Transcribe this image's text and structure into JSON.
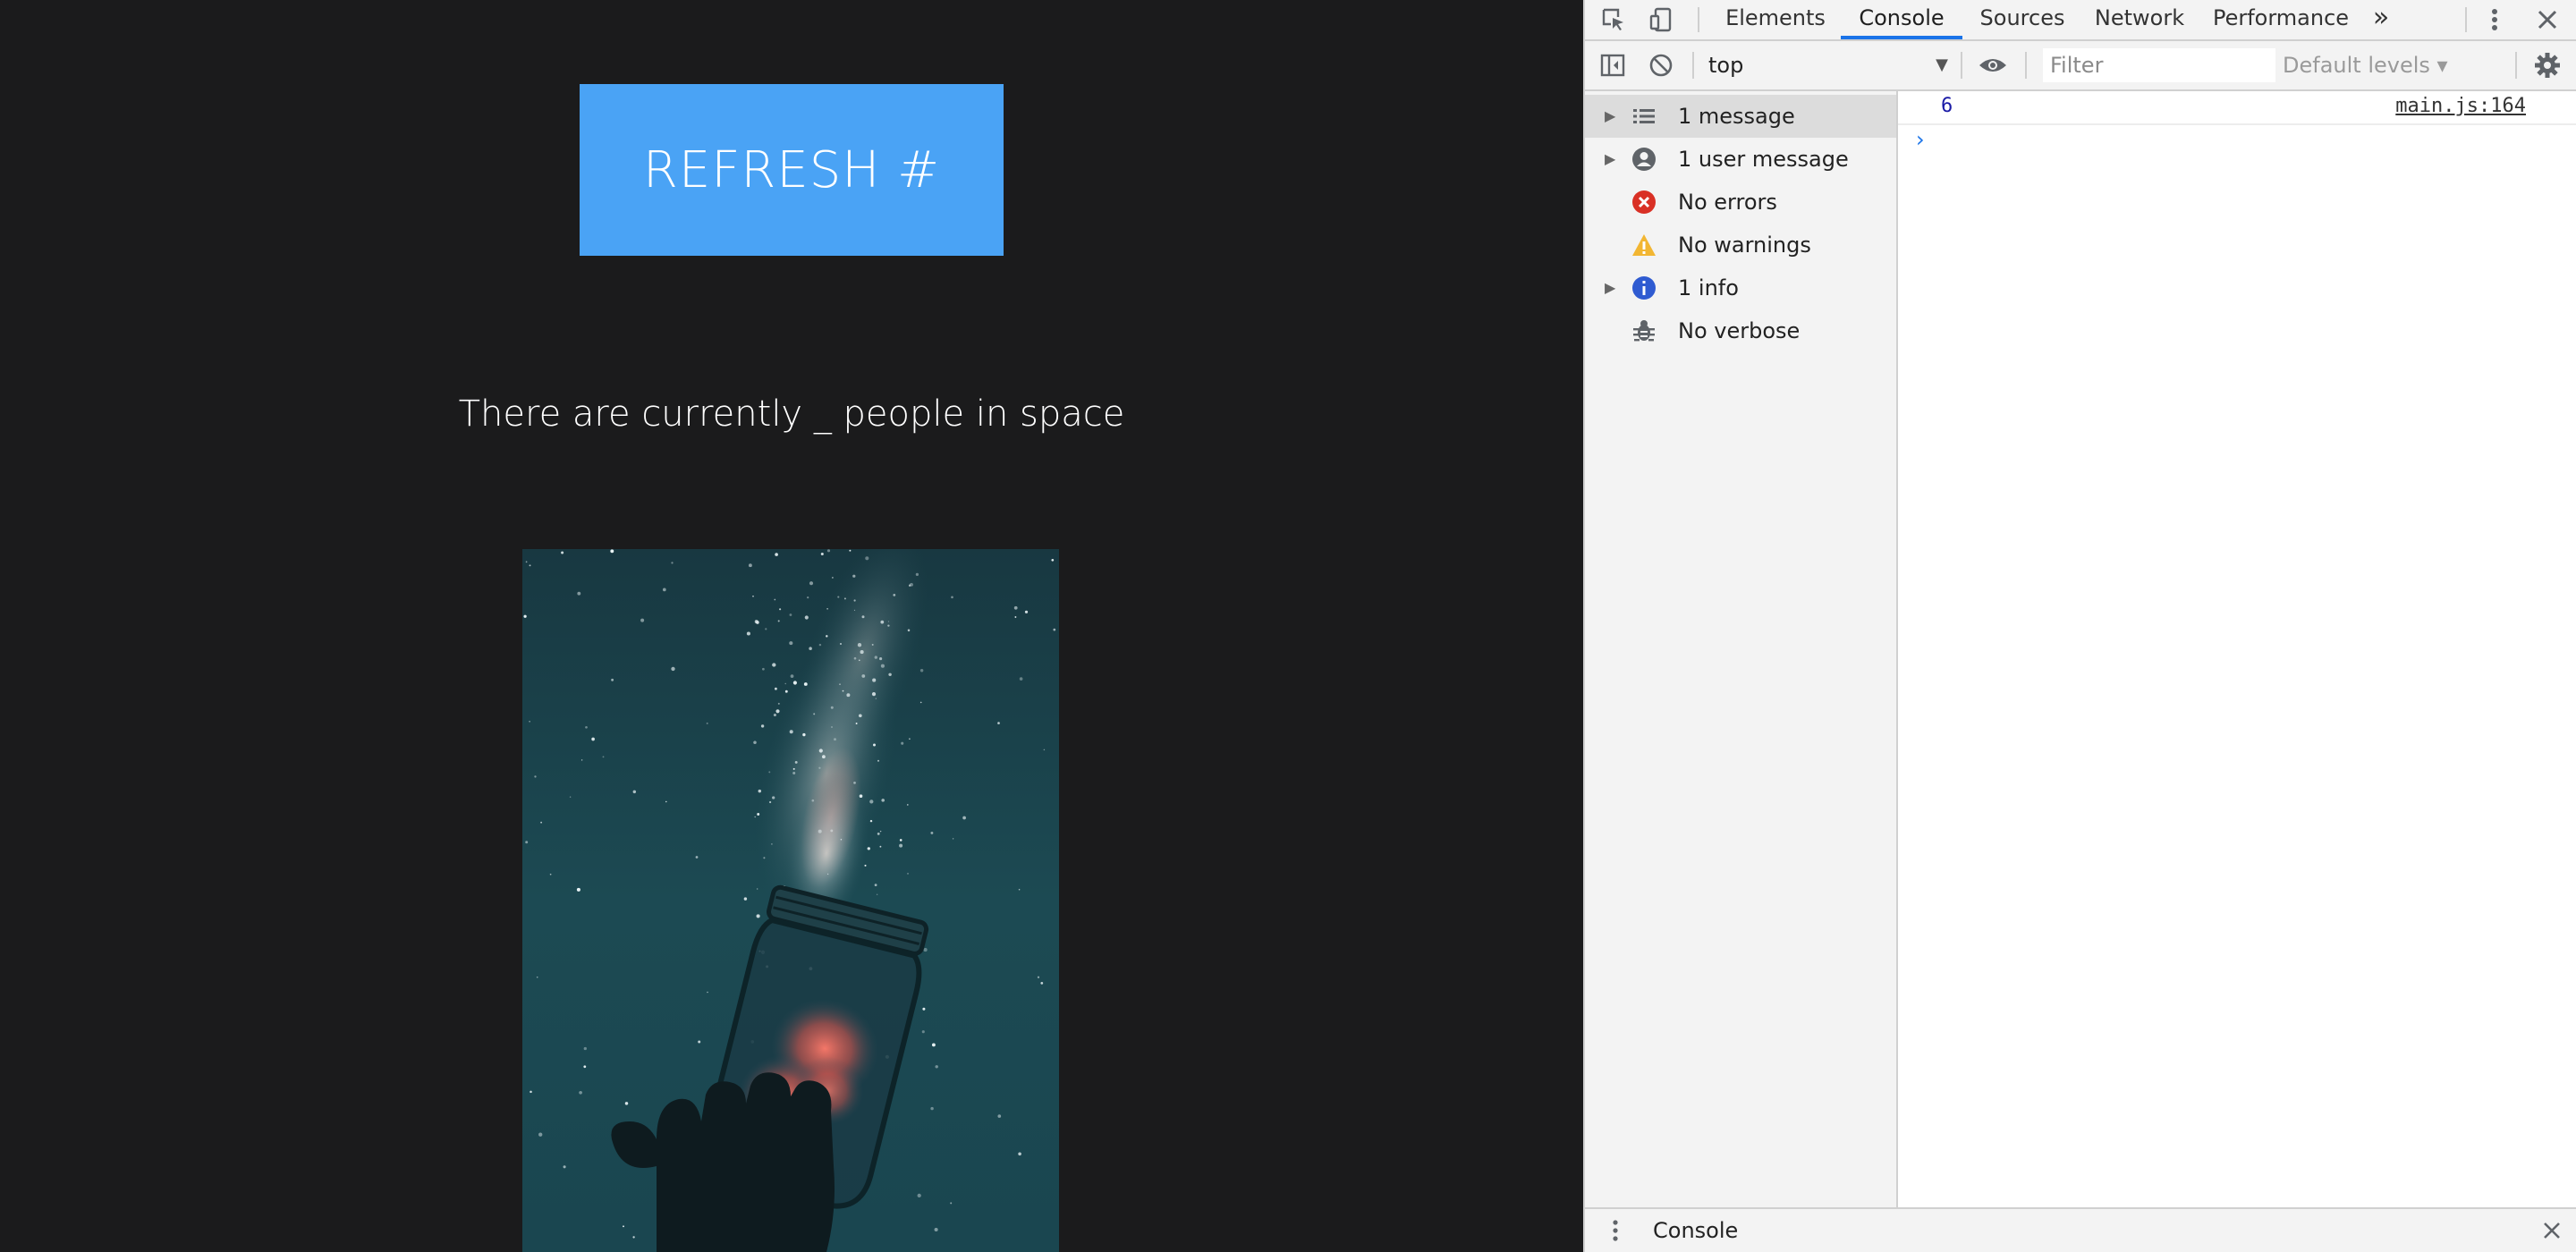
{
  "page": {
    "refresh_button_label": "REFRESH #",
    "headline": "There are currently _ people in space",
    "image_alt": "space-jar-photo"
  },
  "devtools": {
    "tabs": [
      {
        "label": "Elements",
        "active": false
      },
      {
        "label": "Console",
        "active": true
      },
      {
        "label": "Sources",
        "active": false
      },
      {
        "label": "Network",
        "active": false
      },
      {
        "label": "Performance",
        "active": false
      }
    ],
    "more_tabs": "»",
    "toolbar": {
      "context": "top",
      "filter_placeholder": "Filter",
      "levels": "Default levels ▾"
    },
    "sidebar": [
      {
        "label": "1 message",
        "icon": "list-icon",
        "expandable": true,
        "selected": true
      },
      {
        "label": "1 user message",
        "icon": "user-icon",
        "expandable": true,
        "selected": false
      },
      {
        "label": "No errors",
        "icon": "error-icon",
        "expandable": false,
        "selected": false
      },
      {
        "label": "No warnings",
        "icon": "warning-icon",
        "expandable": false,
        "selected": false
      },
      {
        "label": "1 info",
        "icon": "info-icon",
        "expandable": true,
        "selected": false
      },
      {
        "label": "No verbose",
        "icon": "bug-icon",
        "expandable": false,
        "selected": false
      }
    ],
    "console": {
      "message_value": "6",
      "message_source": "main.js:164",
      "prompt": "›"
    },
    "drawer": {
      "title": "Console"
    }
  },
  "colors": {
    "page_bg": "#1b1b1c",
    "button_bg": "#4aa3f5",
    "accent": "#1a73e8",
    "error": "#d93025",
    "warning": "#f2b632",
    "info": "#2f5bd1"
  }
}
